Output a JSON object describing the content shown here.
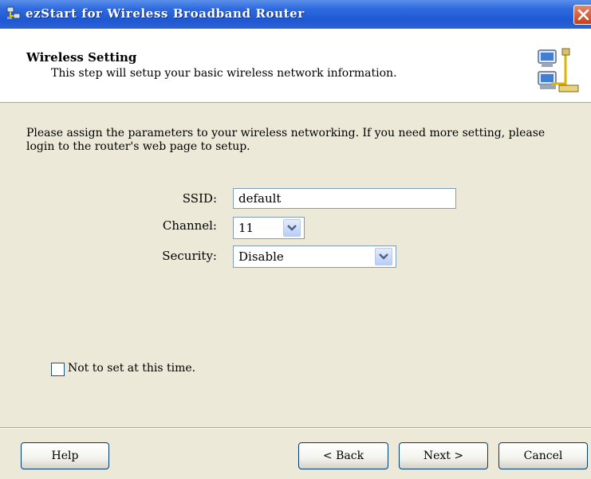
{
  "window": {
    "title": "ezStart for Wireless Broadband Router",
    "close_icon": "close-icon",
    "app_icon": "network-computers-icon"
  },
  "header": {
    "title": "Wireless Setting",
    "subtitle": "This step will setup your basic wireless network information.",
    "icon": "network-computers-icon"
  },
  "main": {
    "intro": "Please assign the parameters to your wireless networking. If you need more setting, please login to the router's web page to setup.",
    "ssid": {
      "label": "SSID:",
      "value": "default"
    },
    "channel": {
      "label": "Channel:",
      "value": "11"
    },
    "security": {
      "label": "Security:",
      "value": "Disable"
    },
    "skip_checkbox": {
      "label": "Not to set at this time.",
      "checked": false
    }
  },
  "footer": {
    "help": "Help",
    "back": "< Back",
    "next": "Next >",
    "cancel": "Cancel"
  },
  "colors": {
    "titlebar": "#2f6be0",
    "dialog_bg": "#ece9d8",
    "header_bg": "#ffffff",
    "close_button": "#c63f18",
    "dropdown_arrow": "#4d6185"
  }
}
